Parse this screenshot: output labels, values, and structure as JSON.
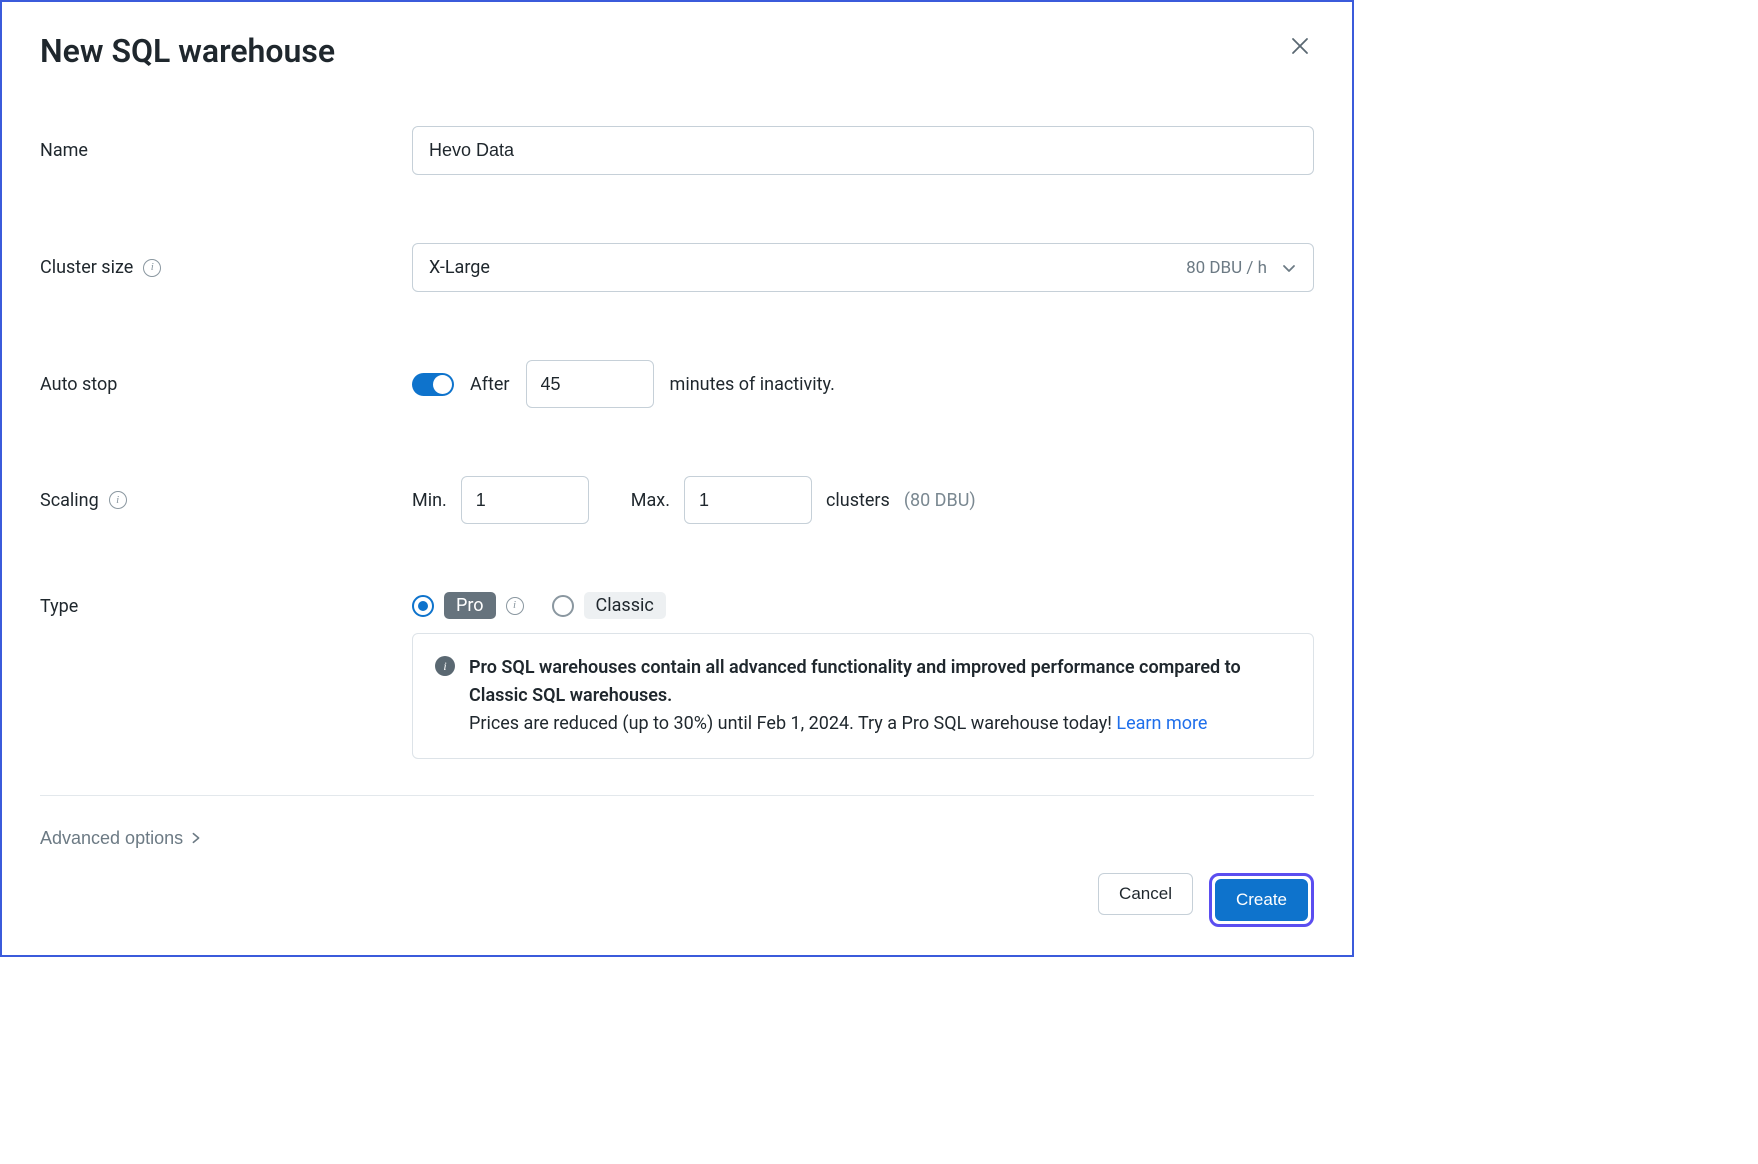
{
  "title": "New SQL warehouse",
  "labels": {
    "name": "Name",
    "cluster_size": "Cluster size",
    "auto_stop": "Auto stop",
    "scaling": "Scaling",
    "type": "Type",
    "advanced": "Advanced options"
  },
  "name": {
    "value": "Hevo Data"
  },
  "cluster_size": {
    "selected": "X-Large",
    "cost": "80 DBU / h"
  },
  "auto_stop": {
    "enabled": true,
    "after_label": "After",
    "minutes": "45",
    "suffix": "minutes of inactivity."
  },
  "scaling": {
    "min_label": "Min.",
    "min": "1",
    "max_label": "Max.",
    "max": "1",
    "clusters_label": "clusters",
    "dbu": "(80 DBU)"
  },
  "type": {
    "options": {
      "pro": "Pro",
      "classic": "Classic"
    },
    "selected": "pro"
  },
  "notice": {
    "heading": "Pro SQL warehouses contain all advanced functionality and improved performance compared to Classic SQL warehouses.",
    "body": "Prices are reduced (up to 30%) until Feb 1, 2024. Try a Pro SQL warehouse today! ",
    "link": "Learn more"
  },
  "buttons": {
    "cancel": "Cancel",
    "create": "Create"
  }
}
